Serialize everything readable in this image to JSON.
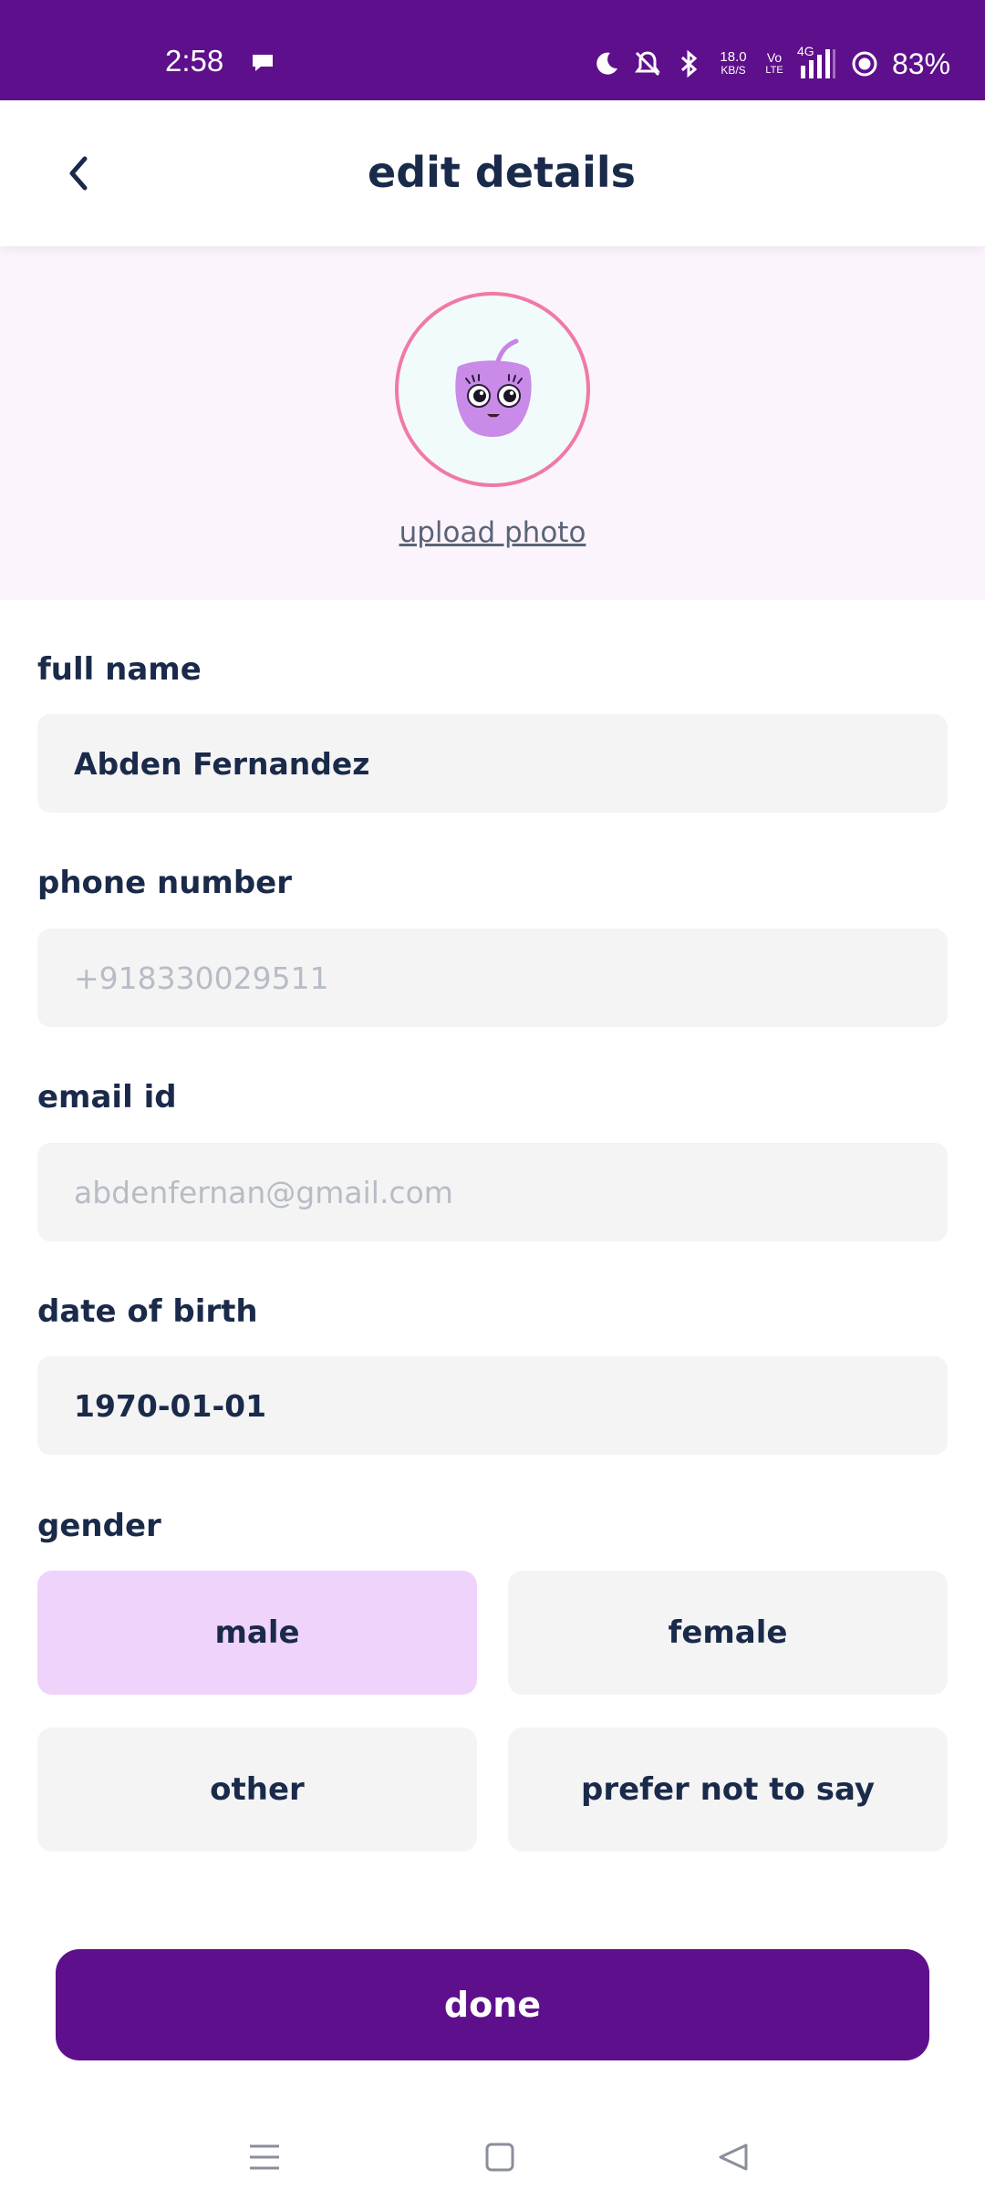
{
  "status_bar": {
    "time": "2:58",
    "net_speed_value": "18.0",
    "net_speed_unit": "KB/S",
    "volte_top": "Vo",
    "volte_bottom": "LTE",
    "network_type": "4G",
    "battery": "83%",
    "icons": [
      "chat-bubble-icon",
      "moon-icon",
      "bell-off-icon",
      "bluetooth-icon",
      "signal-icon",
      "battery-icon"
    ]
  },
  "header": {
    "title": "edit details",
    "back_icon": "chevron-left-icon"
  },
  "profile": {
    "upload_label": "upload photo"
  },
  "form": {
    "full_name": {
      "label": "full name",
      "value": "Abden Fernandez"
    },
    "phone": {
      "label": "phone number",
      "value": "+918330029511"
    },
    "email": {
      "label": "email id",
      "value": "abdenfernan@gmail.com"
    },
    "dob": {
      "label": "date of birth",
      "value": "1970-01-01"
    },
    "gender": {
      "label": "gender",
      "selected": "male",
      "options": [
        "male",
        "female",
        "other",
        "prefer not to say"
      ]
    }
  },
  "done_label": "done",
  "colors": {
    "primary": "#5e0f8b",
    "selected_option": "#f0d3fb",
    "field_bg": "#f4f4f4",
    "avatar_border": "#f07aa4",
    "text": "#1a2a4a"
  },
  "nav_bar": {
    "icons": [
      "menu-icon",
      "home-square-icon",
      "back-triangle-icon"
    ]
  }
}
